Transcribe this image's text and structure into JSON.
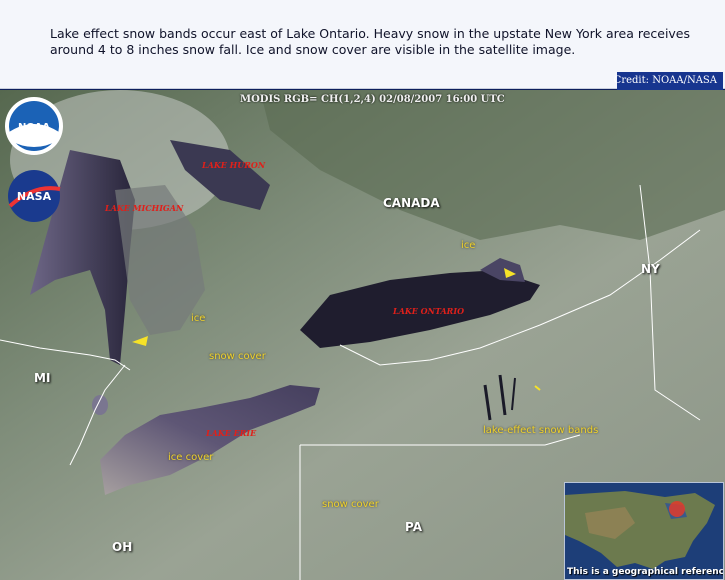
{
  "caption": {
    "text": "Lake effect snow bands occur east of Lake Ontario. Heavy snow in the upstate New York area receives around 4 to 8 inches snow fall. Ice and snow cover are visible in the satellite image."
  },
  "credit": "Credit: NOAA/NASA",
  "satellite_header": "MODIS RGB= CH(1,2,4) 02/08/2007 16:00 UTC",
  "logos": {
    "noaa": "NOAA",
    "nasa": "NASA"
  },
  "regions": {
    "canada": "CANADA",
    "ny": "NY",
    "mi": "MI",
    "oh": "OH",
    "pa": "PA"
  },
  "lakes": {
    "huron": "LAKE HURON",
    "michigan": "LAKE MICHIGAN",
    "ontario": "LAKE ONTARIO",
    "erie": "LAKE ERIE"
  },
  "features": {
    "ice_1": "ice",
    "ice_2": "ice",
    "snow_cover_1": "snow cover",
    "ice_cover": "ice cover",
    "lake_effect": "lake-effect snow bands",
    "snow_cover_2": "snow cover"
  },
  "inset": {
    "label": "This is a geographical reference"
  },
  "colors": {
    "land": "#7a8a7c",
    "lake_dark": "#2c2a40",
    "lake_ice": "#6f6a86",
    "border": "#ffffff",
    "feature_label": "#f0d22a",
    "lake_label": "#e0201a",
    "credit_bg": "#17358f"
  }
}
